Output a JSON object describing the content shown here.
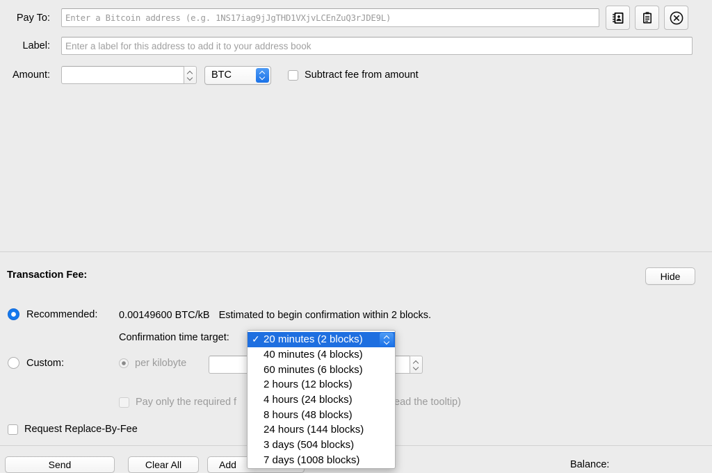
{
  "form": {
    "payto": {
      "label": "Pay To:",
      "placeholder": "Enter a Bitcoin address (e.g. 1NS17iag9jJgTHD1VXjvLCEnZuQ3rJDE9L)",
      "value": ""
    },
    "label_field": {
      "label": "Label:",
      "placeholder": "Enter a label for this address to add it to your address book",
      "value": ""
    },
    "amount": {
      "label": "Amount:",
      "placeholder": "",
      "value": "",
      "unit": "BTC",
      "subtract_fee_label": "Subtract fee from amount"
    },
    "buttons": {
      "address_book_icon": "address-book-icon",
      "paste_icon": "clipboard-paste-icon",
      "clear_icon": "clear-circle-x-icon"
    }
  },
  "fee": {
    "title": "Transaction Fee:",
    "hide_label": "Hide",
    "recommended": {
      "label": "Recommended:",
      "rate": "0.00149600 BTC/kB",
      "estimate": "Estimated to begin confirmation within 2 blocks.",
      "selected": true
    },
    "confirmation_target": {
      "label": "Confirmation time target:",
      "selected": "20 minutes (2 blocks)",
      "options": [
        "20 minutes (2 blocks)",
        "40 minutes (4 blocks)",
        "60 minutes (6 blocks)",
        "2 hours (12 blocks)",
        "4 hours (24 blocks)",
        "8 hours (48 blocks)",
        "24 hours (144 blocks)",
        "3 days (504 blocks)",
        "7 days (1008 blocks)"
      ],
      "check_glyph": "✓"
    },
    "custom": {
      "label": "Custom:",
      "selected": false,
      "per_kilobyte_label": "per kilobyte",
      "per_kilobyte_selected": true,
      "amount_value": "",
      "minimum_fee_label_start": "Pay only the required f",
      "minimum_fee_label_end": "ead the tooltip)"
    },
    "replace_by_fee_label": "Request Replace-By-Fee",
    "replace_by_fee_checked": false
  },
  "bottom": {
    "send_label": "Send",
    "clear_all_label": "Clear All",
    "add_recipient_label": "Add ",
    "balance_label": "Balance:",
    "balance_value": ""
  },
  "colors": {
    "window_bg": "#ececec",
    "accent_blue": "#1e6fe0",
    "field_bg": "#ffffff",
    "border": "#b9b9b9"
  }
}
